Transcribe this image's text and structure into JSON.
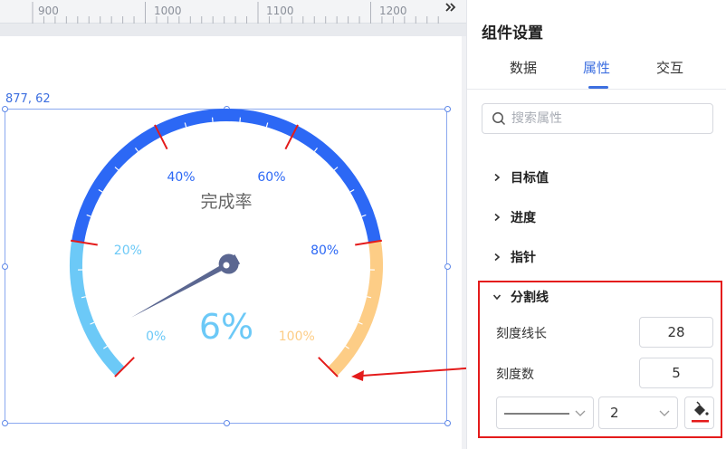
{
  "ruler": {
    "labels": [
      "900",
      "1000",
      "1100",
      "1200"
    ]
  },
  "canvas": {
    "coord_label": "877, 62"
  },
  "gauge": {
    "title": "完成率",
    "value_label": "6%",
    "tick_labels": [
      "0%",
      "20%",
      "40%",
      "60%",
      "80%",
      "100%"
    ],
    "value_percent": 6,
    "colors": {
      "low": "#6cc9f7",
      "mid": "#2c68f5",
      "high": "#fdcd86",
      "pointer": "#5b6791",
      "split_line": "#e41b1b"
    }
  },
  "panel": {
    "title": "组件设置",
    "tabs": [
      "数据",
      "属性",
      "交互"
    ],
    "active_tab": "属性",
    "search_placeholder": "搜索属性",
    "sections": [
      "目标值",
      "进度",
      "指针",
      "分割线"
    ],
    "split_line": {
      "tick_length_label": "刻度线长",
      "tick_length_value": "28",
      "tick_count_label": "刻度数",
      "tick_count_value": "5",
      "line_width_value": "2",
      "color": "#e41b1b"
    }
  },
  "icons": [
    "chevron-double-right-icon",
    "search-icon",
    "chevron-right-icon",
    "chevron-down-icon",
    "paint-bucket-icon"
  ],
  "accent_color": "#3d6fe0",
  "annotation_color": "#e41b1b"
}
